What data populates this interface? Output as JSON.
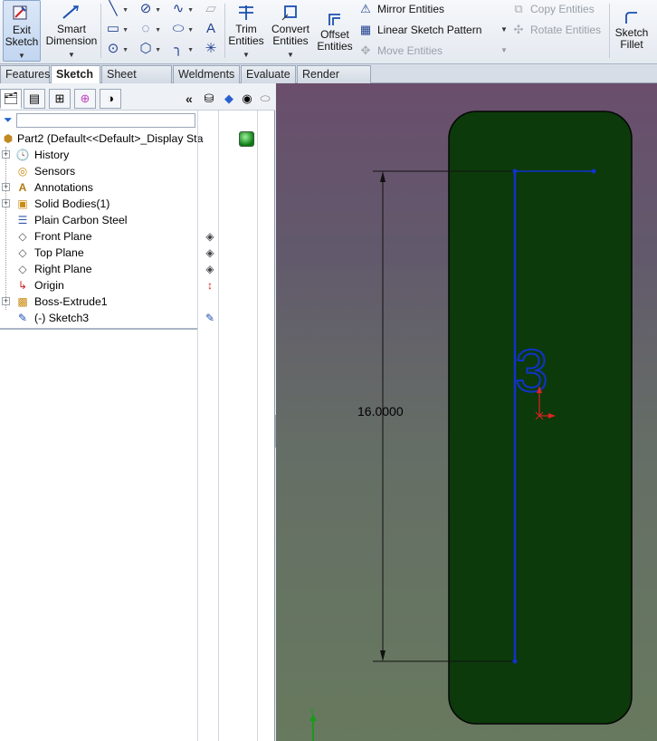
{
  "ribbon": {
    "exit_sketch": "Exit Sketch",
    "smart_dimension": "Smart Dimension",
    "trim_entities": "Trim Entities",
    "convert_entities": "Convert Entities",
    "offset_entities": "Offset Entities",
    "mirror_entities": "Mirror Entities",
    "linear_sketch_pattern": "Linear Sketch Pattern",
    "move_entities": "Move Entities",
    "copy_entities": "Copy Entities",
    "rotate_entities": "Rotate Entities",
    "sketch_fillet": "Sketch Fillet"
  },
  "tabs": [
    "Features",
    "Sketch",
    "Sheet Metal",
    "Weldments",
    "Evaluate",
    "Render Tools"
  ],
  "active_tab": "Sketch",
  "tree": {
    "root": "Part2  (Default<<Default>_Display Sta",
    "items": [
      "History",
      "Sensors",
      "Annotations",
      "Solid Bodies(1)",
      "Plain Carbon Steel",
      "Front Plane",
      "Top Plane",
      "Right Plane",
      "Origin",
      "Boss-Extrude1",
      "(-) Sketch3"
    ]
  },
  "graphics": {
    "dimension_value": "16.0000",
    "sketch_text": "3",
    "axis_label": "Y"
  },
  "colors": {
    "body_fill": "#0c3a0a",
    "sketch_line": "#1133cc",
    "origin": "#dd2222"
  }
}
